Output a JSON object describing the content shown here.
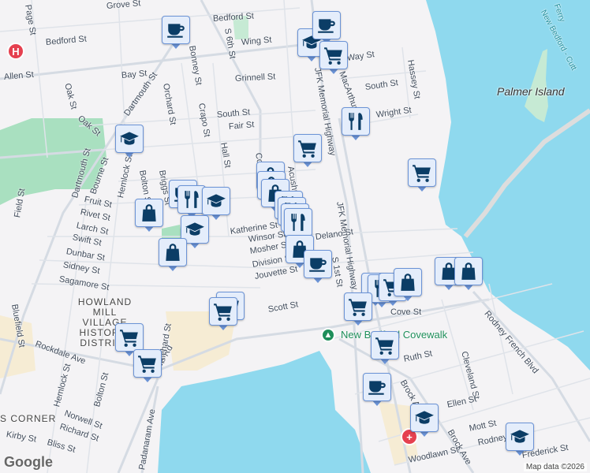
{
  "map": {
    "places": {
      "palmer_island": "Palmer Island",
      "district": "HOWLAND MILL VILLAGE HISTORIC DISTRICT",
      "corner": "S CORNER",
      "covewalk": "New Bedford Covewalk",
      "ferry": "New Bedford - Cutt",
      "ferry2": "Ferry"
    },
    "streets": [
      "Grove St",
      "Bedford St",
      "Bedford St",
      "Wing St",
      "Allen St",
      "Bay St",
      "Dartmouth St",
      "Orchard St",
      "Bonney St",
      "Grinnell St",
      "Oak St",
      "Oak St",
      "South St",
      "Fair St",
      "Crapo St",
      "Hall St",
      "Dartmouth St",
      "Bourne St",
      "Hemlock St",
      "Bolton St",
      "Briggs St",
      "Fruit St",
      "Rivet St",
      "Larch St",
      "Field St",
      "Swift St",
      "Dunbar St",
      "Sidney St",
      "Sagamore St",
      "Bluefield St",
      "Katherine St",
      "Winsor St",
      "Mosher St",
      "Division St",
      "Jouvette St",
      "Scott St",
      "Rockdale Ave",
      "Hemlock St",
      "Bolton St",
      "Norwell St",
      "Richard St",
      "Bliss St",
      "Kirby St",
      "Cove Rd",
      "Padanaram Ave",
      "Richard St",
      "S 6th St",
      "Page St",
      "JFK Memorial Highway",
      "JFK Memorial Highway",
      "MacArthur",
      "South St",
      "Wright St",
      "Hassey St",
      "Way St",
      "S 1st St",
      "Cove St",
      "Rodney French Blvd",
      "Ruth St",
      "Cleveland St",
      "Brock Ave",
      "Brock Ave",
      "Ellen St",
      "Mott St",
      "Rodney",
      "Woodlawn St",
      "Frederick St",
      "Acushnet",
      "Delano St",
      "Co"
    ],
    "markers": [
      "coffee",
      "cap",
      "coffee",
      "cart",
      "utensils",
      "cart",
      "cart",
      "cap",
      "bag",
      "coffee",
      "utensils",
      "cap",
      "cap",
      "bag",
      "bag",
      "bag",
      "bag",
      "utensils",
      "utensils",
      "utensils",
      "utensils",
      "bag",
      "coffee",
      "utensils",
      "utensils",
      "cart",
      "bag",
      "bag",
      "bag",
      "cart",
      "cart",
      "cart",
      "cart",
      "cart",
      "cart",
      "coffee",
      "cap",
      "cap"
    ],
    "hospital_label": "H",
    "colors": {
      "water": "#8fd9ee",
      "park": "#a9e0c0",
      "marker_bg": "#e4edfb",
      "marker_icon": "#0b3d66",
      "hospital": "#e5404f"
    }
  },
  "attribution": {
    "google": "Google",
    "map_data": "Map data ©2026"
  }
}
